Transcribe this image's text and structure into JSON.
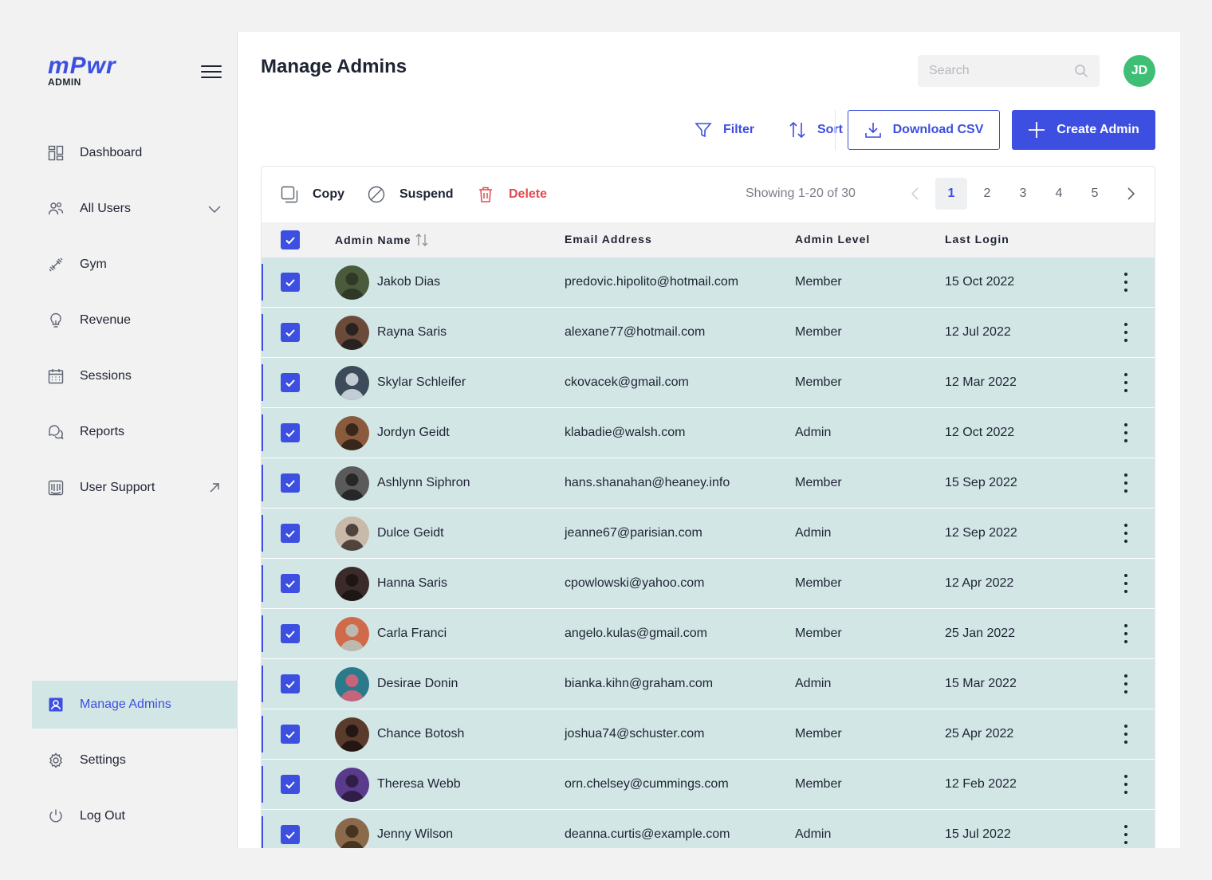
{
  "brand": {
    "logo_text": "mPwr",
    "logo_sub": "ADMIN"
  },
  "sidebar": {
    "items": [
      {
        "label": "Dashboard",
        "icon": "dashboard-icon"
      },
      {
        "label": "All Users",
        "icon": "users-icon"
      },
      {
        "label": "Gym",
        "icon": "dumbbell-icon"
      },
      {
        "label": "Revenue",
        "icon": "lightbulb-icon"
      },
      {
        "label": "Sessions",
        "icon": "calendar-icon"
      },
      {
        "label": "Reports",
        "icon": "chat-icon"
      },
      {
        "label": "User Support",
        "icon": "support-icon"
      }
    ],
    "bottom_items": [
      {
        "label": "Manage Admins",
        "icon": "admin-badge-icon",
        "active": true
      },
      {
        "label": "Settings",
        "icon": "gear-icon"
      },
      {
        "label": "Log Out",
        "icon": "power-icon"
      }
    ]
  },
  "header": {
    "title": "Manage Admins",
    "search_placeholder": "Search",
    "avatar_initials": "JD"
  },
  "toolbar": {
    "filter_label": "Filter",
    "sort_label": "Sort",
    "download_label": "Download CSV",
    "create_label": "Create Admin"
  },
  "bulk_actions": {
    "copy_label": "Copy",
    "suspend_label": "Suspend",
    "delete_label": "Delete",
    "showing_text": "Showing 1-20 of 30"
  },
  "pagination": {
    "pages": [
      "1",
      "2",
      "3",
      "4",
      "5"
    ],
    "current": "1"
  },
  "table": {
    "columns": [
      "Admin Name",
      "Email Address",
      "Admin Level",
      "Last Login"
    ],
    "rows": [
      {
        "name": "Jakob Dias",
        "email": "predovic.hipolito@hotmail.com",
        "level": "Member",
        "login": "15 Oct 2022"
      },
      {
        "name": "Rayna Saris",
        "email": "alexane77@hotmail.com",
        "level": "Member",
        "login": "12 Jul 2022"
      },
      {
        "name": "Skylar Schleifer",
        "email": "ckovacek@gmail.com",
        "level": "Member",
        "login": "12 Mar 2022"
      },
      {
        "name": "Jordyn Geidt",
        "email": "klabadie@walsh.com",
        "level": "Admin",
        "login": "12 Oct 2022"
      },
      {
        "name": "Ashlynn Siphron",
        "email": "hans.shanahan@heaney.info",
        "level": "Member",
        "login": "15 Sep 2022"
      },
      {
        "name": "Dulce Geidt",
        "email": "jeanne67@parisian.com",
        "level": "Admin",
        "login": "12 Sep 2022"
      },
      {
        "name": "Hanna Saris",
        "email": "cpowlowski@yahoo.com",
        "level": "Member",
        "login": "12 Apr 2022"
      },
      {
        "name": "Carla Franci",
        "email": "angelo.kulas@gmail.com",
        "level": "Member",
        "login": "25 Jan 2022"
      },
      {
        "name": "Desirae Donin",
        "email": "bianka.kihn@graham.com",
        "level": "Admin",
        "login": "15 Mar 2022"
      },
      {
        "name": "Chance Botosh",
        "email": "joshua74@schuster.com",
        "level": "Member",
        "login": "25 Apr 2022"
      },
      {
        "name": "Theresa Webb",
        "email": "orn.chelsey@cummings.com",
        "level": "Member",
        "login": "12 Feb 2022"
      },
      {
        "name": "Jenny Wilson",
        "email": "deanna.curtis@example.com",
        "level": "Admin",
        "login": "15 Jul 2022"
      }
    ]
  },
  "colors": {
    "accent": "#3d4fe0",
    "row_selected": "#d2e6e6",
    "danger": "#e5484d",
    "avatar_bg": "#3fbf76"
  }
}
